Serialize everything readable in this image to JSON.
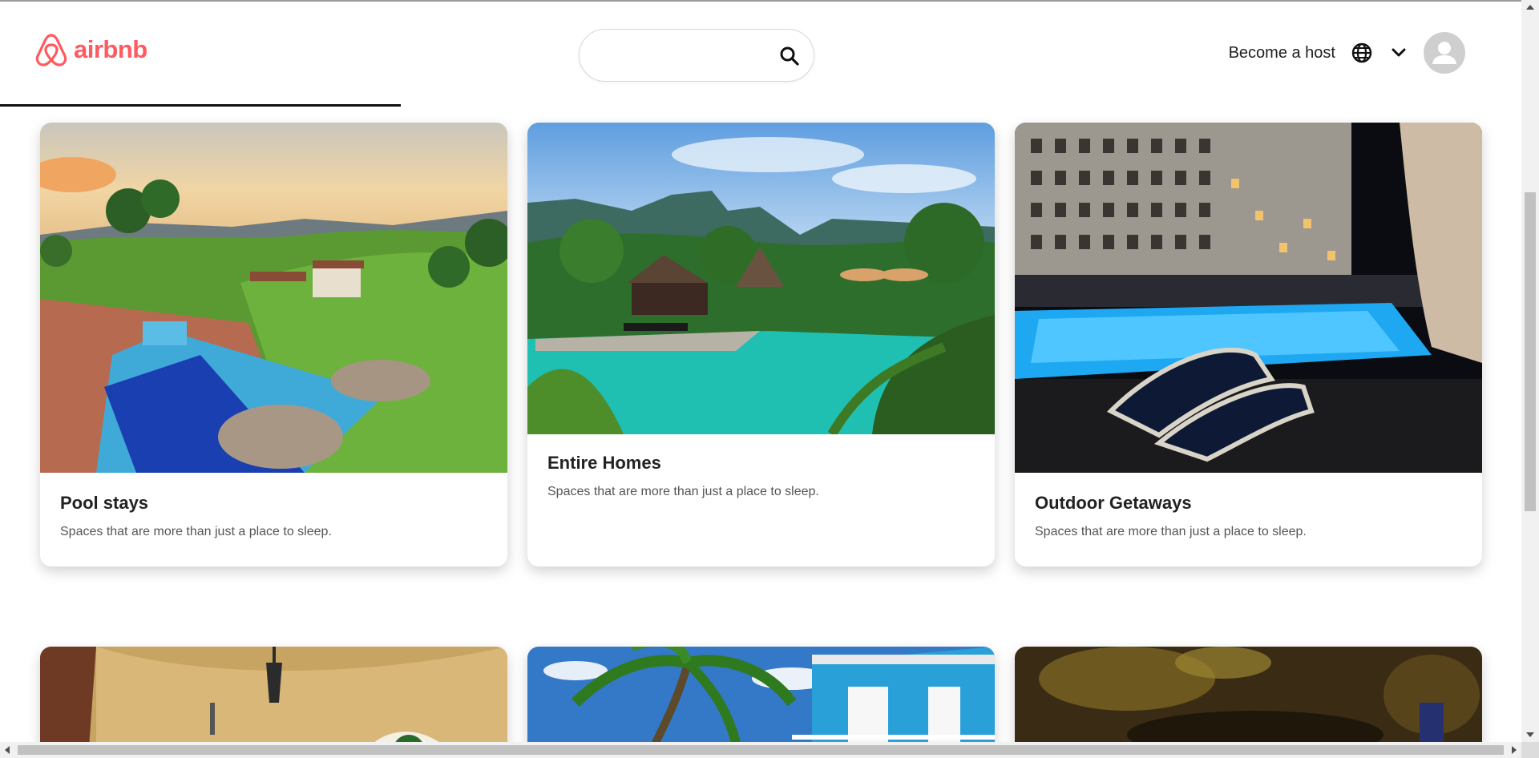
{
  "brand": {
    "name": "airbnb",
    "color": "#ff5a5f",
    "icon": "airbnb-logo-icon"
  },
  "search": {
    "placeholder": "",
    "value": "",
    "icon": "search-icon"
  },
  "header": {
    "host_link": "Become a host",
    "language_icon": "globe-icon",
    "menu_icon": "chevron-down-icon",
    "avatar_icon": "user-avatar-icon"
  },
  "cards": [
    {
      "title": "Pool stays",
      "description": "Spaces that are more than just a place to sleep.",
      "image": "pool-hillside-sunset-image"
    },
    {
      "title": "Entire Homes",
      "description": "Spaces that are more than just a place to sleep.",
      "image": "tropical-pool-resort-image"
    },
    {
      "title": "Outdoor Getaways",
      "description": "Spaces that are more than just a place to sleep.",
      "image": "night-hotel-pool-image"
    }
  ],
  "next_row_images": [
    "stone-archway-lantern-image",
    "palm-tree-blue-house-image",
    "blurred-night-lights-image"
  ]
}
